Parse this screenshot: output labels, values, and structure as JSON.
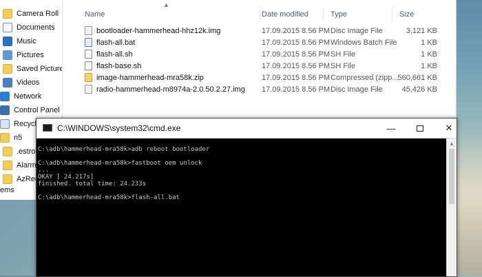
{
  "nav": {
    "items": [
      {
        "label": "Camera Roll",
        "icon": "folder-icon"
      },
      {
        "label": "Documents",
        "icon": "documents-icon"
      },
      {
        "label": "Music",
        "icon": "music-icon"
      },
      {
        "label": "Pictures",
        "icon": "pictures-icon"
      },
      {
        "label": "Saved Pictures",
        "icon": "folder-icon"
      },
      {
        "label": "Videos",
        "icon": "videos-icon"
      },
      {
        "label": "Network",
        "icon": "network-icon"
      },
      {
        "label": "Control Panel",
        "icon": "control-panel-icon"
      },
      {
        "label": "Recycle",
        "icon": "recycle-bin-icon"
      },
      {
        "label": "n5",
        "icon": "folder-icon"
      },
      {
        "label": ".estror",
        "icon": "folder-icon"
      },
      {
        "label": "Alarms",
        "icon": "folder-icon"
      },
      {
        "label": "AzRec",
        "icon": "folder-icon"
      },
      {
        "label": "ems",
        "icon": ""
      }
    ]
  },
  "files": {
    "columns": {
      "name": "Name",
      "date": "Date modified",
      "type": "Type",
      "size": "Size"
    },
    "rows": [
      {
        "name": "bootloader-hammerhead-hhz12k.img",
        "date": "17.09.2015 8.56 PM",
        "type": "Disc Image File",
        "size": "3,121 KB",
        "icon": "disc-image-icon"
      },
      {
        "name": "flash-all.bat",
        "date": "17.09.2015 8.56 PM",
        "type": "Windows Batch File",
        "size": "1 KB",
        "icon": "batch-file-icon"
      },
      {
        "name": "flash-all.sh",
        "date": "17.09.2015 8.56 PM",
        "type": "SH File",
        "size": "1 KB",
        "icon": "file-icon"
      },
      {
        "name": "flash-base.sh",
        "date": "17.09.2015 8.56 PM",
        "type": "SH File",
        "size": "1 KB",
        "icon": "file-icon"
      },
      {
        "name": "image-hammerhead-mra58k.zip",
        "date": "17.09.2015 8.56 PM",
        "type": "Compressed (zipp...",
        "size": "560,661 KB",
        "icon": "zip-icon"
      },
      {
        "name": "radio-hammerhead-m8974a-2.0.50.2.27.img",
        "date": "17.09.2015 8.56 PM",
        "type": "Disc Image File",
        "size": "45,426 KB",
        "icon": "disc-image-icon"
      }
    ]
  },
  "cmd": {
    "title": "C:\\WINDOWS\\system32\\cmd.exe",
    "lines": [
      "",
      "C:\\adb\\hammerhead-mra58k>adb reboot bootloader",
      "",
      "C:\\adb\\hammerhead-mra58k>fastboot oem unlock",
      "...",
      "OKAY [ 24.217s]",
      "finished. total time: 24.233s",
      "",
      "C:\\adb\\hammerhead-mra58k>flash-all.bat"
    ]
  }
}
